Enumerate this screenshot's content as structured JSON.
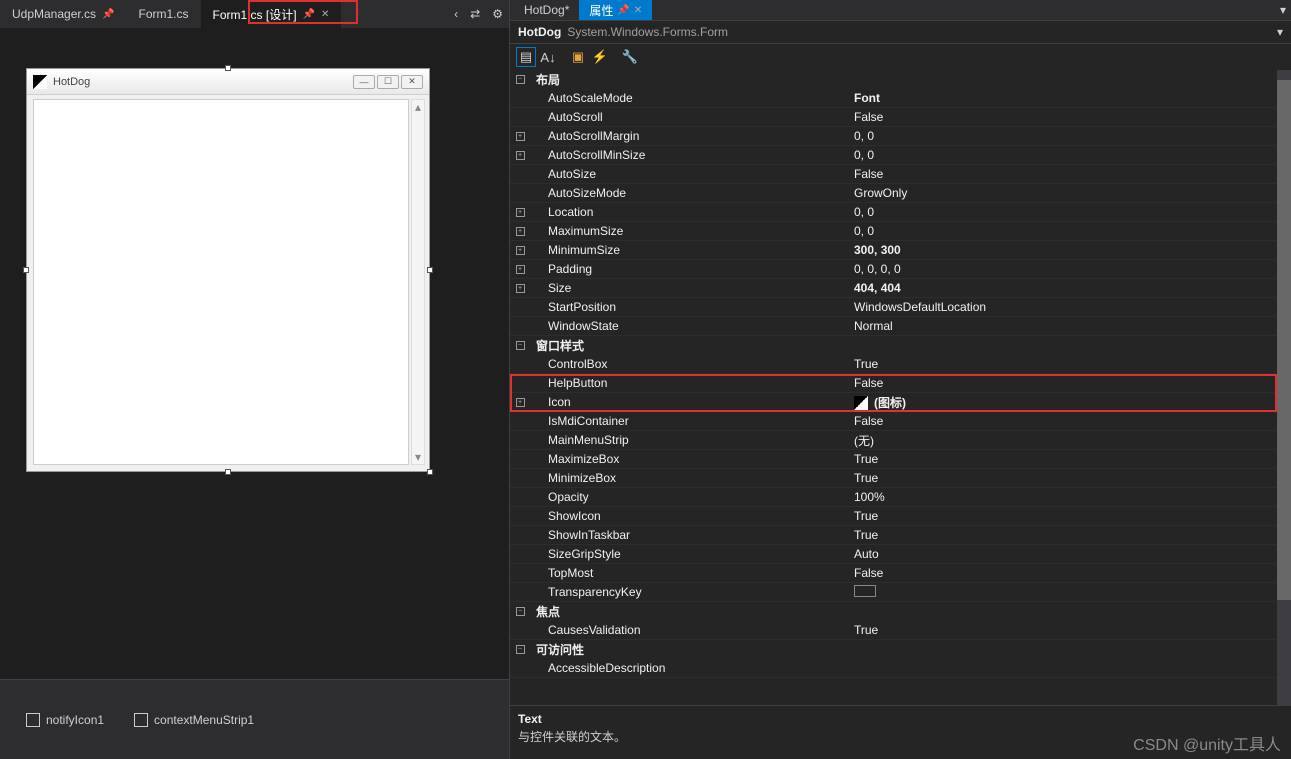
{
  "leftTabs": [
    {
      "label": "UdpManager.cs",
      "active": false,
      "pinned": true
    },
    {
      "label": "Form1.cs",
      "active": false,
      "pinned": false
    },
    {
      "label": "Form1.cs [设计]",
      "active": true,
      "pinned": true
    }
  ],
  "rightTabs": [
    {
      "label": "HotDog*",
      "active": false
    },
    {
      "label": "属性",
      "active": true,
      "pinned": true
    }
  ],
  "formDesigner": {
    "title": "HotDog"
  },
  "tray": [
    {
      "label": "notifyIcon1"
    },
    {
      "label": "contextMenuStrip1"
    }
  ],
  "selectedObject": {
    "name": "HotDog",
    "type": "System.Windows.Forms.Form"
  },
  "categories": [
    {
      "name": "布局",
      "expanded": true,
      "props": [
        {
          "name": "AutoScaleMode",
          "val": "Font",
          "bold": true
        },
        {
          "name": "AutoScroll",
          "val": "False"
        },
        {
          "name": "AutoScrollMargin",
          "val": "0, 0",
          "exp": true
        },
        {
          "name": "AutoScrollMinSize",
          "val": "0, 0",
          "exp": true
        },
        {
          "name": "AutoSize",
          "val": "False"
        },
        {
          "name": "AutoSizeMode",
          "val": "GrowOnly"
        },
        {
          "name": "Location",
          "val": "0, 0",
          "exp": true
        },
        {
          "name": "MaximumSize",
          "val": "0, 0",
          "exp": true
        },
        {
          "name": "MinimumSize",
          "val": "300, 300",
          "bold": true,
          "exp": true
        },
        {
          "name": "Padding",
          "val": "0, 0, 0, 0",
          "exp": true
        },
        {
          "name": "Size",
          "val": "404, 404",
          "bold": true,
          "exp": true
        },
        {
          "name": "StartPosition",
          "val": "WindowsDefaultLocation"
        },
        {
          "name": "WindowState",
          "val": "Normal"
        }
      ]
    },
    {
      "name": "窗口样式",
      "expanded": true,
      "props": [
        {
          "name": "ControlBox",
          "val": "True"
        },
        {
          "name": "HelpButton",
          "val": "False"
        },
        {
          "name": "Icon",
          "val": "(图标)",
          "exp": true,
          "icon": true,
          "highlight": true
        },
        {
          "name": "IsMdiContainer",
          "val": "False"
        },
        {
          "name": "MainMenuStrip",
          "val": "(无)"
        },
        {
          "name": "MaximizeBox",
          "val": "True"
        },
        {
          "name": "MinimizeBox",
          "val": "True"
        },
        {
          "name": "Opacity",
          "val": "100%"
        },
        {
          "name": "ShowIcon",
          "val": "True"
        },
        {
          "name": "ShowInTaskbar",
          "val": "True"
        },
        {
          "name": "SizeGripStyle",
          "val": "Auto"
        },
        {
          "name": "TopMost",
          "val": "False"
        },
        {
          "name": "TransparencyKey",
          "val": "",
          "swatch": true
        }
      ]
    },
    {
      "name": "焦点",
      "expanded": true,
      "props": [
        {
          "name": "CausesValidation",
          "val": "True"
        }
      ]
    },
    {
      "name": "可访问性",
      "expanded": true,
      "props": [
        {
          "name": "AccessibleDescription",
          "val": ""
        }
      ]
    }
  ],
  "description": {
    "title": "Text",
    "text": "与控件关联的文本。"
  },
  "watermark": "CSDN @unity工具人"
}
